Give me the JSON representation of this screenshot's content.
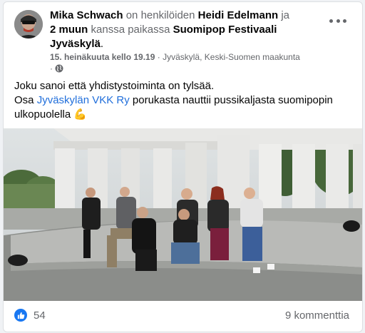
{
  "post": {
    "author": "Mika Schwach",
    "with_text": "on henkilöiden",
    "tagged_person": "Heidi Edelmann",
    "and_text": "ja",
    "others": "2 muun",
    "place_text": "kanssa paikassa",
    "place": "Suomipop Festivaali Jyväskylä",
    "end_dot": ".",
    "date": "15. heinäkuuta kello 19.19",
    "separator": "·",
    "location": "Jyväskylä, Keski-Suomen maakunta",
    "privacy_sep": "·",
    "privacy_icon": "globe-icon",
    "text_line1": "Joku sanoi että yhdistystoiminta on tylsää.",
    "text_line2_prefix": "Osa",
    "text_link": "Jyväskylän VKK Ry",
    "text_line2_suffix": "porukasta nauttii pussikaljasta suomipopin ulkopuolella",
    "emoji": "💪"
  },
  "reactions": {
    "icon": "thumbs-up-icon",
    "count": "54",
    "color": "#1877f2"
  },
  "comments": {
    "label": "9 kommenttia"
  },
  "colors": {
    "link": "#216fdb",
    "muted": "#65676b",
    "accent": "#1877f2"
  }
}
